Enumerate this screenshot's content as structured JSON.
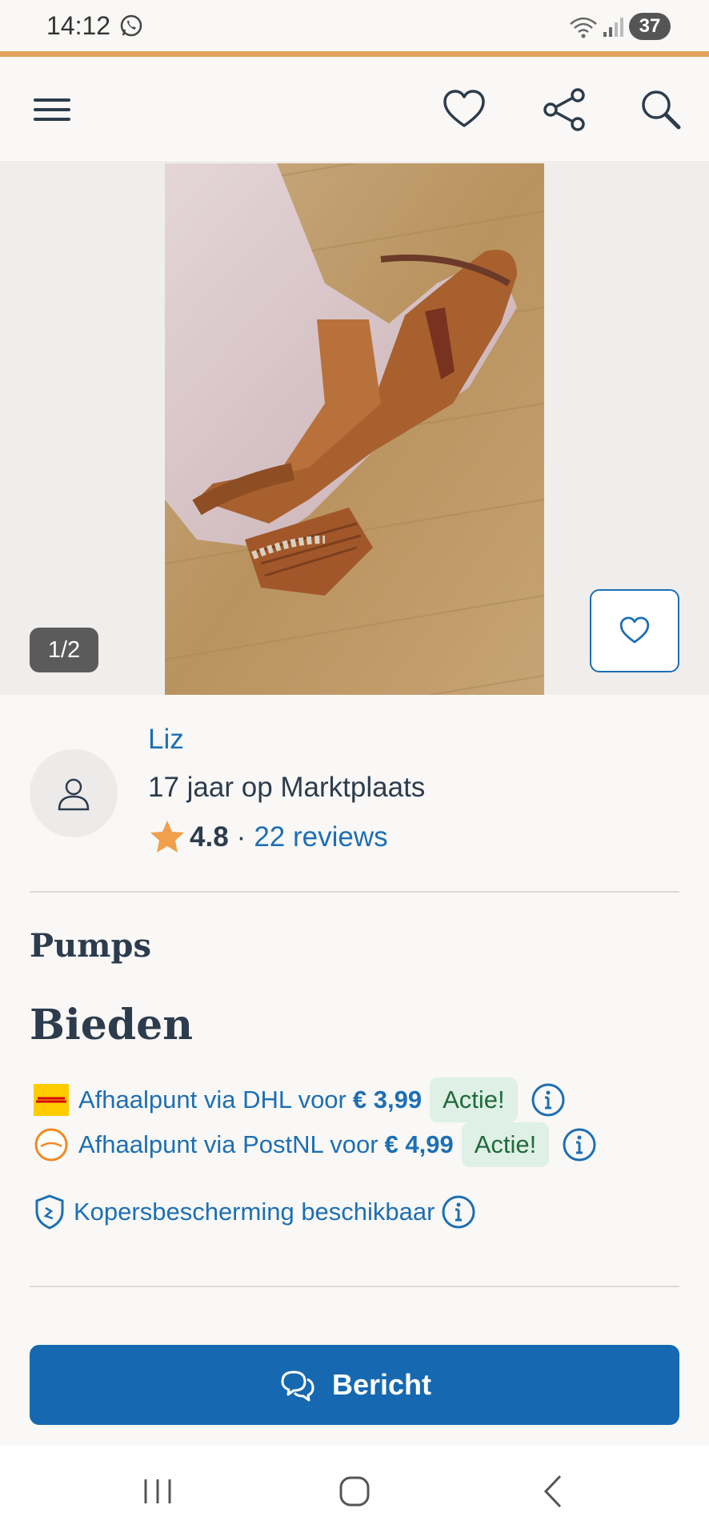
{
  "status_bar": {
    "time": "14:12",
    "battery": "37"
  },
  "header": {
    "menu_icon": "hamburger-icon",
    "favorite_icon": "heart-icon",
    "share_icon": "share-icon",
    "search_icon": "search-icon"
  },
  "gallery": {
    "counter": "1/2"
  },
  "seller": {
    "name": "Liz",
    "membership": "17 jaar op Marktplaats",
    "rating": "4.8",
    "separator": "·",
    "reviews": "22 reviews"
  },
  "listing": {
    "title": "Pumps",
    "price": "Bieden"
  },
  "shipping": [
    {
      "text": "Afhaalpunt via DHL voor ",
      "price": "€ 3,99",
      "badge": "Actie!",
      "carrier_logo": "DHL"
    },
    {
      "text": "Afhaalpunt via PostNL voor ",
      "price": "€ 4,99",
      "badge": "Actie!",
      "carrier_logo": "postnl"
    }
  ],
  "buyer_protection": "Kopersbescherming beschikbaar",
  "cta": {
    "label": "Bericht"
  },
  "colors": {
    "accent": "#e1a15b",
    "primary": "#1669b0",
    "link": "#1d6fb4",
    "badge_bg": "#dff0e6",
    "star": "#f0a04b"
  }
}
